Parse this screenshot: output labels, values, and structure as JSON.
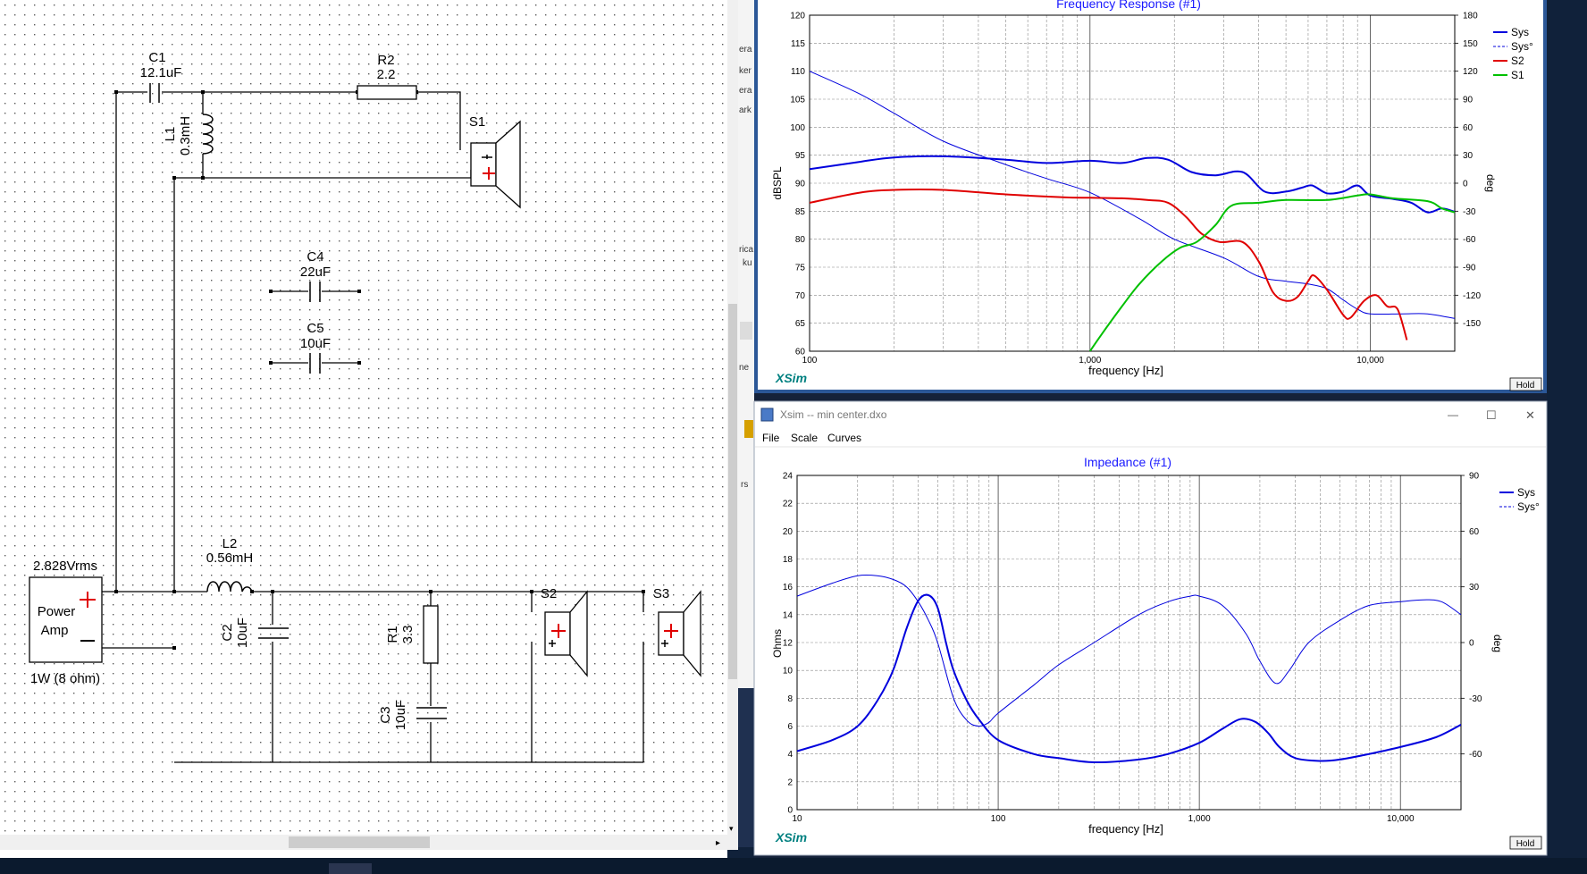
{
  "schematic": {
    "source": {
      "voltage": "2.828Vrms",
      "name_line1": "Power",
      "name_line2": "Amp",
      "power": "1W (8 ohm)"
    },
    "components": {
      "c1": {
        "name": "C1",
        "value": "12.1uF"
      },
      "r2": {
        "name": "R2",
        "value": "2.2"
      },
      "l1": {
        "name": "L1",
        "value": "0.3mH"
      },
      "c4": {
        "name": "C4",
        "value": "22uF"
      },
      "c5": {
        "name": "C5",
        "value": "10uF"
      },
      "l2": {
        "name": "L2",
        "value": "0.56mH"
      },
      "c2": {
        "name": "C2",
        "value": "10uF"
      },
      "r1": {
        "name": "R1",
        "value": "3.3"
      },
      "c3": {
        "name": "C3",
        "value": "10uF"
      },
      "s1": {
        "name": "S1"
      },
      "s2": {
        "name": "S2"
      },
      "s3": {
        "name": "S3"
      }
    }
  },
  "background_fragments": [
    "era",
    "ker",
    "era",
    "ark",
    "rica",
    "ku",
    "ne",
    "rs"
  ],
  "freq_window": {
    "title": "Frequency Response (#1)",
    "brand": "XSim",
    "hold_label": "Hold",
    "xlabel": "frequency [Hz]",
    "ylabel_left": "dBSPL",
    "ylabel_right": "deg"
  },
  "imp_window": {
    "window_title": "Xsim -- min center.dxo",
    "menu": [
      "File",
      "Scale",
      "Curves"
    ],
    "title": "Impedance (#1)",
    "brand": "XSim",
    "hold_label": "Hold",
    "xlabel": "frequency [Hz]",
    "ylabel_left": "Ohms",
    "ylabel_right": "deg",
    "controls": {
      "minimize": "—",
      "maximize": "☐",
      "close": "✕"
    }
  },
  "colors": {
    "sys": "#0000dd",
    "s2": "#e00000",
    "s1": "#00c000",
    "title": "#1a1aff",
    "brand": "#008080"
  },
  "chart_data": [
    {
      "type": "line",
      "title": "Frequency Response (#1)",
      "xlabel": "frequency [Hz]",
      "ylabel": "dBSPL",
      "y2label": "deg",
      "xscale": "log",
      "xlim": [
        100,
        20000
      ],
      "ylim": [
        60,
        120
      ],
      "y2lim": [
        -180,
        180
      ],
      "xticks": [
        {
          "v": 100,
          "l": "100"
        },
        {
          "v": 1000,
          "l": "1,000"
        },
        {
          "v": 10000,
          "l": "10,000"
        }
      ],
      "yticks": [
        60,
        65,
        70,
        75,
        80,
        85,
        90,
        95,
        100,
        105,
        110,
        115,
        120
      ],
      "y2ticks": [
        -150,
        -120,
        -90,
        -60,
        -30,
        0,
        30,
        60,
        90,
        120,
        150,
        180
      ],
      "grid": true,
      "legend_position": "top-right",
      "series": [
        {
          "name": "Sys",
          "axis": "left",
          "style": "solid",
          "width": 2,
          "color": "#0000dd",
          "x": [
            100,
            150,
            200,
            300,
            500,
            700,
            1000,
            1300,
            1600,
            1900,
            2300,
            2800,
            3500,
            4200,
            5000,
            5700,
            6200,
            7000,
            8000,
            9000,
            10000,
            12000,
            14000,
            16000,
            18000,
            20000
          ],
          "y": [
            92.5,
            93.8,
            94.6,
            94.8,
            94.2,
            93.6,
            94,
            93.6,
            94.5,
            94.2,
            92,
            91.4,
            92,
            88.5,
            88.5,
            89.2,
            89.6,
            88.2,
            88.5,
            89.6,
            87.8,
            87.2,
            86.5,
            84.8,
            85.5,
            84.9
          ]
        },
        {
          "name": "Sys°",
          "axis": "right",
          "style": "solid",
          "width": 1,
          "color": "#0000dd",
          "x": [
            100,
            150,
            200,
            300,
            500,
            700,
            1000,
            1500,
            2000,
            3000,
            4000,
            5000,
            6000,
            7000,
            8000,
            9000,
            10000,
            13000,
            16000,
            20000
          ],
          "y": [
            120,
            96,
            75,
            45,
            20,
            5,
            -10,
            -38,
            -60,
            -80,
            -100,
            -105,
            -108,
            -113,
            -125,
            -135,
            -140,
            -140,
            -140,
            -145
          ]
        },
        {
          "name": "S2",
          "axis": "left",
          "style": "solid",
          "width": 2,
          "color": "#e00000",
          "x": [
            100,
            150,
            200,
            300,
            500,
            800,
            1000,
            1300,
            1600,
            1900,
            2200,
            2500,
            2900,
            3500,
            4000,
            4500,
            5000,
            5500,
            6000,
            6300,
            7000,
            8000,
            8500,
            9500,
            10500,
            11500,
            12500,
            13500
          ],
          "y": [
            86.5,
            88.3,
            88.8,
            88.8,
            88,
            87.5,
            87.4,
            87.3,
            87,
            86.5,
            84,
            81,
            79.5,
            79.5,
            76,
            70.5,
            69,
            69.7,
            72.5,
            73.5,
            71,
            66.5,
            66,
            69,
            70,
            68,
            67.5,
            62
          ]
        },
        {
          "name": "S1",
          "axis": "left",
          "style": "solid",
          "width": 2,
          "color": "#00c000",
          "x": [
            1000,
            1100,
            1300,
            1500,
            1800,
            2100,
            2400,
            2800,
            3200,
            4000,
            5000,
            7000,
            9000,
            10000,
            12000,
            16000,
            18000,
            20000
          ],
          "y": [
            60,
            63,
            68,
            72,
            76,
            78.5,
            79.5,
            82.5,
            86,
            86.5,
            87,
            87,
            87.8,
            88,
            87.3,
            86.8,
            85.5,
            84.8
          ]
        }
      ]
    },
    {
      "type": "line",
      "title": "Impedance (#1)",
      "xlabel": "frequency [Hz]",
      "ylabel": "Ohms",
      "y2label": "deg",
      "xscale": "log",
      "xlim": [
        10,
        20000
      ],
      "ylim": [
        0,
        24
      ],
      "y2lim": [
        -90,
        90
      ],
      "xticks": [
        {
          "v": 10,
          "l": "10"
        },
        {
          "v": 100,
          "l": "100"
        },
        {
          "v": 1000,
          "l": "1,000"
        },
        {
          "v": 10000,
          "l": "10,000"
        }
      ],
      "yticks": [
        0,
        2,
        4,
        6,
        8,
        10,
        12,
        14,
        16,
        18,
        20,
        22,
        24
      ],
      "y2ticks": [
        -60,
        -30,
        0,
        30,
        60,
        90
      ],
      "grid": true,
      "legend_position": "top-right",
      "series": [
        {
          "name": "Sys",
          "axis": "left",
          "style": "solid",
          "width": 2,
          "color": "#0000dd",
          "x": [
            10,
            15,
            20,
            25,
            30,
            35,
            40,
            45,
            50,
            55,
            60,
            70,
            80,
            100,
            150,
            200,
            300,
            500,
            700,
            1000,
            1300,
            1600,
            1900,
            2200,
            2500,
            3000,
            4000,
            5000,
            7000,
            10000,
            15000,
            20000
          ],
          "y": [
            4.2,
            5,
            6,
            7.8,
            10,
            13,
            15,
            15.4,
            14.5,
            12,
            10,
            7.8,
            6.5,
            5,
            4,
            3.7,
            3.4,
            3.6,
            4,
            4.8,
            5.8,
            6.5,
            6.3,
            5.5,
            4.5,
            3.7,
            3.5,
            3.6,
            4,
            4.5,
            5.2,
            6.1
          ]
        },
        {
          "name": "Sys°",
          "axis": "right",
          "style": "solid",
          "width": 1,
          "color": "#0000dd",
          "x": [
            10,
            15,
            20,
            25,
            30,
            35,
            40,
            45,
            50,
            60,
            70,
            80,
            90,
            100,
            150,
            200,
            300,
            500,
            700,
            900,
            1000,
            1300,
            1700,
            2000,
            2400,
            2800,
            3500,
            5000,
            7000,
            10000,
            13000,
            16000,
            20000
          ],
          "y": [
            25,
            32,
            36,
            36,
            34,
            30,
            22,
            12,
            0,
            -30,
            -42,
            -45,
            -43,
            -38,
            -23,
            -12,
            0,
            15,
            22,
            25,
            25,
            20,
            5,
            -10,
            -22,
            -15,
            0,
            12,
            20,
            22,
            23,
            22,
            15
          ]
        }
      ]
    }
  ]
}
